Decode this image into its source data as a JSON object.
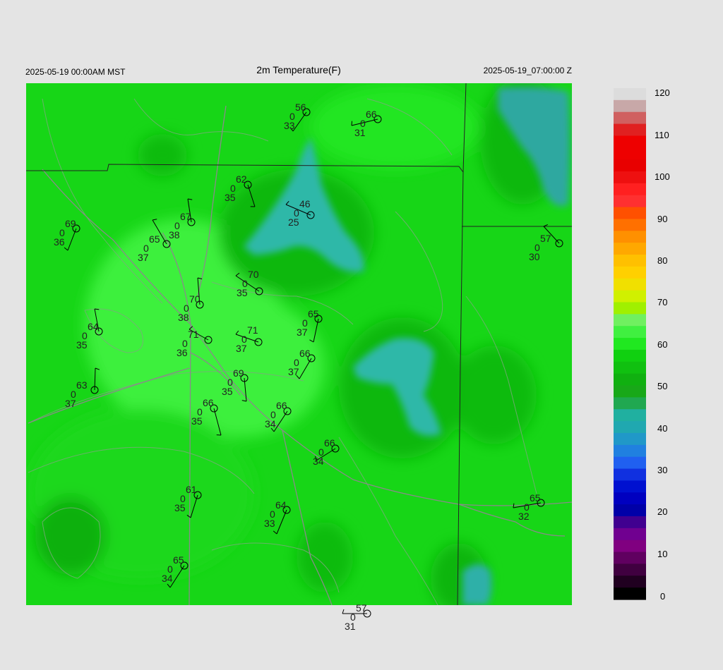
{
  "header": {
    "left": "2025-05-19 00:00AM MST",
    "title": "2m Temperature(F)",
    "right": "2025-05-19_07:00:00 Z"
  },
  "colorbar": {
    "ticks": [
      "120",
      "110",
      "100",
      "90",
      "80",
      "70",
      "60",
      "50",
      "40",
      "30",
      "20",
      "10",
      "0"
    ]
  },
  "stations": [
    {
      "id": "s1",
      "temp": "56",
      "mid": "0",
      "dew": "33"
    },
    {
      "id": "s2",
      "temp": "66",
      "mid": "0",
      "dew": "31"
    },
    {
      "id": "s3",
      "temp": "62",
      "mid": "0",
      "dew": "35"
    },
    {
      "id": "s4",
      "temp": "46",
      "mid": "0",
      "dew": "25"
    },
    {
      "id": "s5",
      "temp": "69",
      "mid": "0",
      "dew": "36"
    },
    {
      "id": "s6",
      "temp": "67",
      "mid": "0",
      "dew": "38"
    },
    {
      "id": "s7",
      "temp": "65",
      "mid": "0",
      "dew": "37"
    },
    {
      "id": "s8",
      "temp": "57",
      "mid": "0",
      "dew": "30"
    },
    {
      "id": "s9",
      "temp": "70",
      "mid": "0",
      "dew": "35"
    },
    {
      "id": "s10",
      "temp": "70",
      "mid": "0",
      "dew": "38"
    },
    {
      "id": "s11",
      "temp": "65",
      "mid": "0",
      "dew": "37"
    },
    {
      "id": "s12",
      "temp": "64",
      "mid": "0",
      "dew": "35"
    },
    {
      "id": "s13",
      "temp": "71",
      "mid": "0",
      "dew": "36"
    },
    {
      "id": "s14",
      "temp": "71",
      "mid": "0",
      "dew": "37"
    },
    {
      "id": "s15",
      "temp": "66",
      "mid": "0",
      "dew": "37"
    },
    {
      "id": "s16",
      "temp": "63",
      "mid": "0",
      "dew": "37"
    },
    {
      "id": "s17",
      "temp": "69",
      "mid": "0",
      "dew": "35"
    },
    {
      "id": "s18",
      "temp": "66",
      "mid": "0",
      "dew": "35"
    },
    {
      "id": "s19",
      "temp": "66",
      "mid": "0",
      "dew": "34"
    },
    {
      "id": "s20",
      "temp": "66",
      "mid": "0",
      "dew": "34"
    },
    {
      "id": "s21",
      "temp": "61",
      "mid": "0",
      "dew": "35"
    },
    {
      "id": "s22",
      "temp": "65",
      "mid": "0",
      "dew": "32"
    },
    {
      "id": "s23",
      "temp": "64",
      "mid": "0",
      "dew": "33"
    },
    {
      "id": "s24",
      "temp": "65",
      "mid": "0",
      "dew": "34"
    },
    {
      "id": "s25",
      "temp": "57",
      "mid": "0",
      "dew": "31"
    }
  ]
}
